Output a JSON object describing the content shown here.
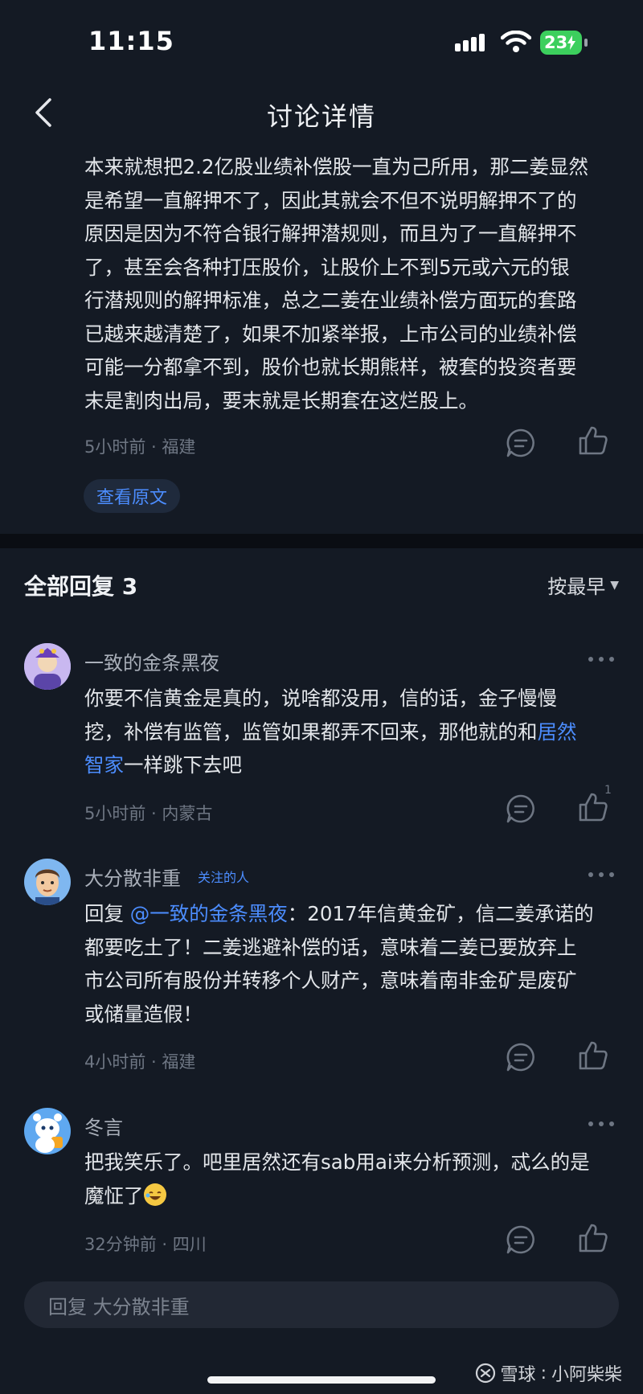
{
  "status_bar": {
    "time": "11:15",
    "battery": "23"
  },
  "nav": {
    "title": "讨论详情"
  },
  "post": {
    "lines": [
      "本来就想把2.2亿股业绩补偿股一直为己所用，那二姜显然",
      "是希望一直解押不了，因此其就会不但不说明解押不了的",
      "原因是因为不符合银行解押潜规则，而且为了一直解押不",
      "了，甚至会各种打压股价，让股价上不到5元或六元的银",
      "行潜规则的解押标准，总之二姜在业绩补偿方面玩的套路",
      "已越来越清楚了，如果不加紧举报，上市公司的业绩补偿",
      "可能一分都拿不到，股价也就长期熊样，被套的投资者要",
      "末是割肉出局，要末就是长期套在这烂股上。"
    ],
    "meta": "5小时前 · 福建",
    "view_original": "查看原文"
  },
  "replies": {
    "header": "全部回复 3",
    "sort_label": "按最早",
    "items": [
      {
        "username": "一致的金条黑夜",
        "line1": "你要不信黄金是真的，说啥都没用，信的话，金子慢慢",
        "line2_text": "挖，补偿有监管，监管如果都弄不回来，那他就的和",
        "line2_link": "居然",
        "line3_link": "智家",
        "line3_text": "一样跳下去吧",
        "meta": "5小时前 · 内蒙古",
        "like_count": "1"
      },
      {
        "username": "大分散非重",
        "badge": "关注的人",
        "reply_prefix": "回复 ",
        "mention": "@一致的金条黑夜",
        "line1_rest": "：2017年信黄金矿，信二姜承诺的",
        "line2": "都要吃土了！二姜逃避补偿的话，意味着二姜已要放弃上",
        "line3": "市公司所有股份并转移个人财产，意味着南非金矿是废矿",
        "line4": "或储量造假！",
        "meta": "4小时前 · 福建"
      },
      {
        "username": "冬言",
        "line1": "把我笑乐了。吧里居然还有sab用ai来分析预测，忒么的是",
        "line2": "魔怔了",
        "meta": "32分钟前 · 四川"
      }
    ]
  },
  "reply_bar": {
    "placeholder": "回复 大分散非重"
  },
  "watermark": {
    "brand": "雪球",
    "author": "小阿柴柴"
  },
  "colors": {
    "background": "#141a24",
    "accent": "#4c8dff",
    "battery": "#3ccf5d"
  }
}
